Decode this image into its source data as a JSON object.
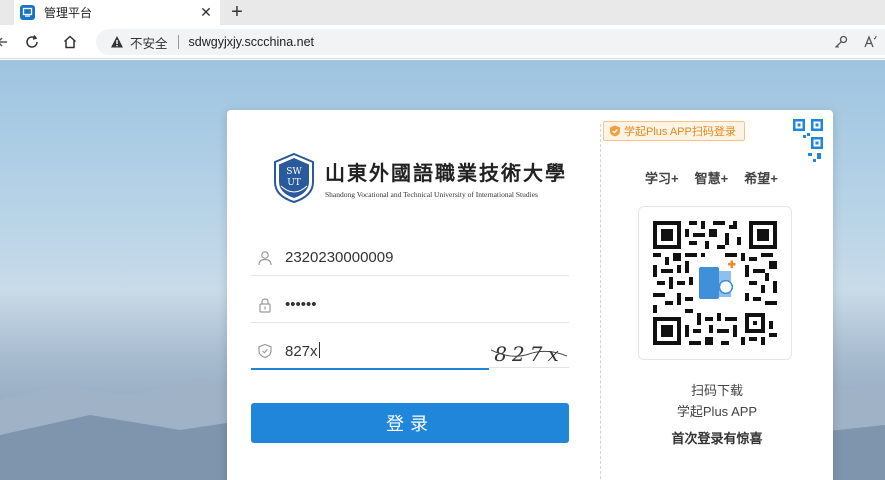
{
  "browser": {
    "tab_title": "管理平台",
    "tab_close": "✕",
    "new_tab": "+",
    "security_label": "不安全",
    "url": "sdwgyjxjy.sccchina.net"
  },
  "logo": {
    "badge_top": "SW",
    "badge_bottom": "UT",
    "name_cn": "山東外國語職業技術大學",
    "name_en": "Shandong Vocational and Technical University of International Studies"
  },
  "form": {
    "username": "2320230000009",
    "password_mask": "••••••",
    "captcha_input": "827x",
    "captcha_image_text": "827x",
    "login_button": "登录"
  },
  "right_panel": {
    "scan_tag": "学起Plus APP扫码登录",
    "slogans": [
      "学习+",
      "智慧+",
      "希望+"
    ],
    "caption_line1": "扫码下载",
    "caption_line2": "学起Plus APP",
    "caption_line3": "首次登录有惊喜"
  },
  "colors": {
    "primary": "#1f86d9",
    "accent_orange": "#e08a1f"
  }
}
